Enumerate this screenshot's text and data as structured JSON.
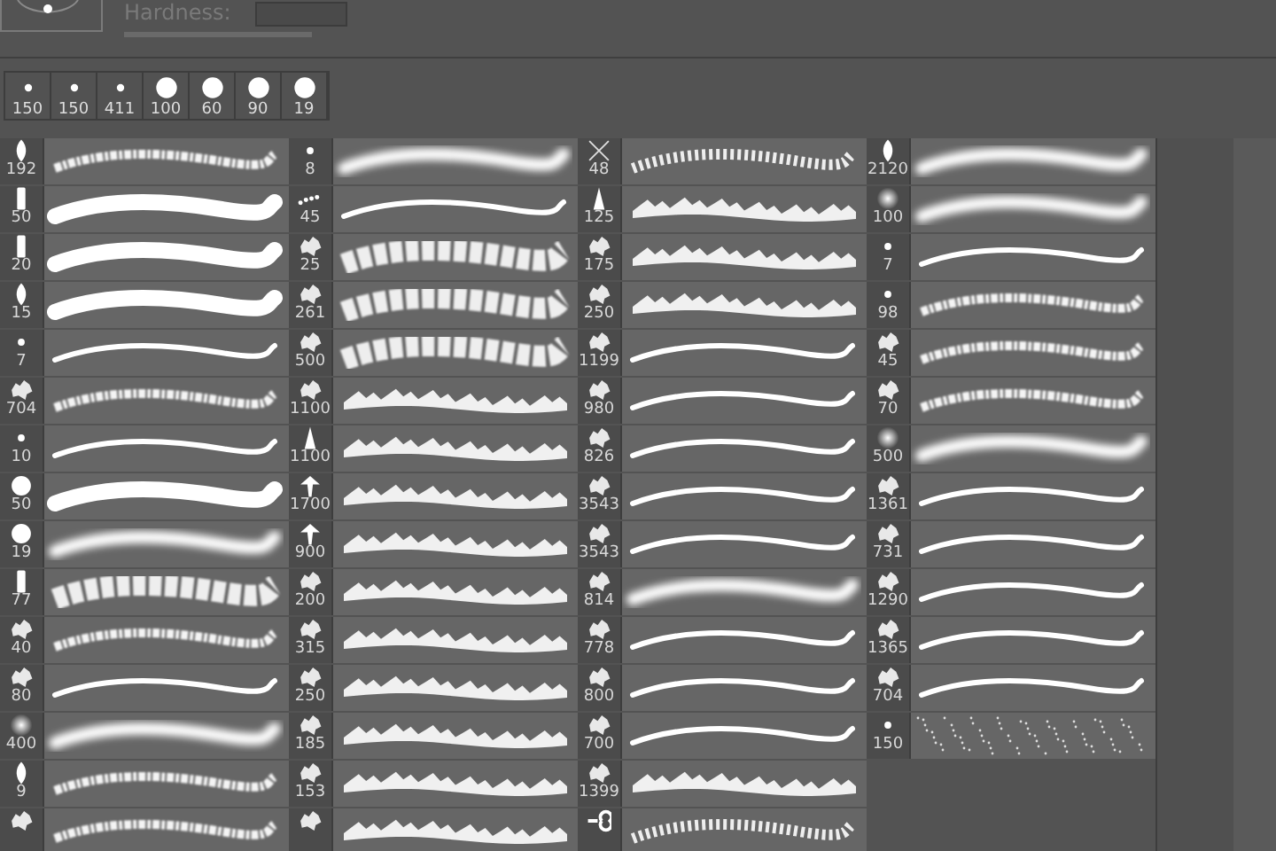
{
  "brush_settings": {
    "hardness_label": "Hardness:"
  },
  "recent_presets": [
    {
      "size": "150",
      "tip": {
        "kind": "dot"
      },
      "selected": false
    },
    {
      "size": "150",
      "tip": {
        "kind": "dot"
      },
      "selected": false
    },
    {
      "size": "411",
      "tip": {
        "kind": "dot"
      },
      "selected": false
    },
    {
      "size": "100",
      "tip": {
        "kind": "round"
      },
      "selected": false
    },
    {
      "size": "60",
      "tip": {
        "kind": "round"
      },
      "selected": false
    },
    {
      "size": "90",
      "tip": {
        "kind": "round"
      },
      "selected": false
    },
    {
      "size": "19",
      "tip": {
        "kind": "round"
      },
      "selected": false
    }
  ],
  "brush_columns": [
    {
      "items": [
        {
          "size": "192",
          "tip": {
            "kind": "leaf"
          },
          "stroke": {
            "kind": "rough"
          },
          "selected": false
        },
        {
          "size": "50",
          "tip": {
            "kind": "bar"
          },
          "stroke": {
            "kind": "thick"
          },
          "selected": false
        },
        {
          "size": "20",
          "tip": {
            "kind": "bar"
          },
          "stroke": {
            "kind": "thick"
          },
          "selected": false
        },
        {
          "size": "15",
          "tip": {
            "kind": "leaf"
          },
          "stroke": {
            "kind": "thick"
          },
          "selected": false
        },
        {
          "size": "7",
          "tip": {
            "kind": "dot"
          },
          "stroke": {
            "kind": "hard"
          },
          "selected": false
        },
        {
          "size": "704",
          "tip": {
            "kind": "blob"
          },
          "stroke": {
            "kind": "rough"
          },
          "selected": false
        },
        {
          "size": "10",
          "tip": {
            "kind": "dot"
          },
          "stroke": {
            "kind": "hard"
          },
          "selected": false
        },
        {
          "size": "50",
          "tip": {
            "kind": "round"
          },
          "stroke": {
            "kind": "thick"
          },
          "selected": false
        },
        {
          "size": "19",
          "tip": {
            "kind": "round"
          },
          "stroke": {
            "kind": "soft"
          },
          "selected": false
        },
        {
          "size": "77",
          "tip": {
            "kind": "bar"
          },
          "stroke": {
            "kind": "cloud"
          },
          "selected": false
        },
        {
          "size": "40",
          "tip": {
            "kind": "blob"
          },
          "stroke": {
            "kind": "rough"
          },
          "selected": false
        },
        {
          "size": "80",
          "tip": {
            "kind": "blob"
          },
          "stroke": {
            "kind": "hard"
          },
          "selected": false
        },
        {
          "size": "400",
          "tip": {
            "kind": "soft"
          },
          "stroke": {
            "kind": "soft"
          },
          "selected": false
        },
        {
          "size": "9",
          "tip": {
            "kind": "leaf"
          },
          "stroke": {
            "kind": "rough"
          },
          "selected": false
        },
        {
          "tip": {
            "kind": "blob"
          },
          "stroke": {
            "kind": "rough"
          },
          "selected": false
        }
      ]
    },
    {
      "items": [
        {
          "size": "8",
          "tip": {
            "kind": "dot"
          },
          "stroke": {
            "kind": "soft"
          },
          "selected": false
        },
        {
          "size": "45",
          "tip": {
            "kind": "dots"
          },
          "stroke": {
            "kind": "hard"
          },
          "selected": false
        },
        {
          "size": "25",
          "tip": {
            "kind": "blob"
          },
          "stroke": {
            "kind": "cloud"
          },
          "selected": false
        },
        {
          "size": "261",
          "tip": {
            "kind": "blob"
          },
          "stroke": {
            "kind": "cloud"
          },
          "selected": false
        },
        {
          "size": "500",
          "tip": {
            "kind": "blob"
          },
          "stroke": {
            "kind": "cloud"
          },
          "selected": false
        },
        {
          "size": "1100",
          "tip": {
            "kind": "blob"
          },
          "stroke": {
            "kind": "foliage"
          },
          "selected": false
        },
        {
          "size": "1100",
          "tip": {
            "kind": "cone"
          },
          "stroke": {
            "kind": "foliage"
          },
          "selected": false
        },
        {
          "size": "1700",
          "tip": {
            "kind": "tree"
          },
          "stroke": {
            "kind": "foliage"
          },
          "selected": false
        },
        {
          "size": "900",
          "tip": {
            "kind": "tree"
          },
          "stroke": {
            "kind": "foliage"
          },
          "selected": false
        },
        {
          "size": "200",
          "tip": {
            "kind": "blob"
          },
          "stroke": {
            "kind": "foliage"
          },
          "selected": false
        },
        {
          "size": "315",
          "tip": {
            "kind": "blob"
          },
          "stroke": {
            "kind": "foliage"
          },
          "selected": false
        },
        {
          "size": "250",
          "tip": {
            "kind": "blob"
          },
          "stroke": {
            "kind": "foliage"
          },
          "selected": false
        },
        {
          "size": "185",
          "tip": {
            "kind": "blob"
          },
          "stroke": {
            "kind": "foliage"
          },
          "selected": false
        },
        {
          "size": "153",
          "tip": {
            "kind": "blob"
          },
          "stroke": {
            "kind": "foliage"
          },
          "selected": false
        },
        {
          "tip": {
            "kind": "blob"
          },
          "stroke": {
            "kind": "foliage"
          },
          "selected": false
        }
      ]
    },
    {
      "items": [
        {
          "size": "48",
          "tip": {
            "kind": "cross"
          },
          "stroke": {
            "kind": "chain"
          },
          "selected": false
        },
        {
          "size": "125",
          "tip": {
            "kind": "cone"
          },
          "stroke": {
            "kind": "foliage"
          },
          "selected": false
        },
        {
          "size": "175",
          "tip": {
            "kind": "blob"
          },
          "stroke": {
            "kind": "foliage"
          },
          "selected": false
        },
        {
          "size": "250",
          "tip": {
            "kind": "blob"
          },
          "stroke": {
            "kind": "foliage"
          },
          "selected": false
        },
        {
          "size": "1199",
          "tip": {
            "kind": "blob"
          },
          "stroke": {
            "kind": "hard"
          },
          "selected": false
        },
        {
          "size": "980",
          "tip": {
            "kind": "blob"
          },
          "stroke": {
            "kind": "hard"
          },
          "selected": false
        },
        {
          "size": "826",
          "tip": {
            "kind": "blob"
          },
          "stroke": {
            "kind": "hard"
          },
          "selected": false
        },
        {
          "size": "3543",
          "tip": {
            "kind": "blob"
          },
          "stroke": {
            "kind": "hard"
          },
          "selected": false
        },
        {
          "size": "3543",
          "tip": {
            "kind": "blob"
          },
          "stroke": {
            "kind": "hard"
          },
          "selected": false
        },
        {
          "size": "814",
          "tip": {
            "kind": "blob"
          },
          "stroke": {
            "kind": "soft"
          },
          "selected": false
        },
        {
          "size": "778",
          "tip": {
            "kind": "blob"
          },
          "stroke": {
            "kind": "hard"
          },
          "selected": false
        },
        {
          "size": "800",
          "tip": {
            "kind": "blob"
          },
          "stroke": {
            "kind": "hard"
          },
          "selected": false
        },
        {
          "size": "700",
          "tip": {
            "kind": "blob"
          },
          "stroke": {
            "kind": "hard"
          },
          "selected": false
        },
        {
          "size": "1399",
          "tip": {
            "kind": "blob"
          },
          "stroke": {
            "kind": "foliage"
          },
          "selected": false
        },
        {
          "tip": {
            "kind": "chain"
          },
          "stroke": {
            "kind": "chain"
          },
          "selected": false
        }
      ]
    },
    {
      "items": [
        {
          "size": "2120",
          "tip": {
            "kind": "leaf"
          },
          "stroke": {
            "kind": "soft"
          },
          "selected": false
        },
        {
          "size": "100",
          "tip": {
            "kind": "soft"
          },
          "stroke": {
            "kind": "soft"
          },
          "selected": false
        },
        {
          "size": "7",
          "tip": {
            "kind": "dot"
          },
          "stroke": {
            "kind": "hard"
          },
          "selected": false
        },
        {
          "size": "98",
          "tip": {
            "kind": "dot"
          },
          "stroke": {
            "kind": "rough"
          },
          "selected": false
        },
        {
          "size": "45",
          "tip": {
            "kind": "blob"
          },
          "stroke": {
            "kind": "rough"
          },
          "selected": false
        },
        {
          "size": "70",
          "tip": {
            "kind": "blob"
          },
          "stroke": {
            "kind": "rough"
          },
          "selected": false
        },
        {
          "size": "500",
          "tip": {
            "kind": "soft"
          },
          "stroke": {
            "kind": "soft"
          },
          "selected": false
        },
        {
          "size": "1361",
          "tip": {
            "kind": "blob"
          },
          "stroke": {
            "kind": "hard"
          },
          "selected": false
        },
        {
          "size": "731",
          "tip": {
            "kind": "blob"
          },
          "stroke": {
            "kind": "hard"
          },
          "selected": false
        },
        {
          "size": "1290",
          "tip": {
            "kind": "blob"
          },
          "stroke": {
            "kind": "hard"
          },
          "selected": false
        },
        {
          "size": "1365",
          "tip": {
            "kind": "blob"
          },
          "stroke": {
            "kind": "hard"
          },
          "selected": false
        },
        {
          "size": "704",
          "tip": {
            "kind": "blob"
          },
          "stroke": {
            "kind": "hard"
          },
          "selected": false
        },
        {
          "size": "150",
          "tip": {
            "kind": "dot"
          },
          "stroke": {
            "kind": "spray"
          },
          "selected": false
        }
      ]
    }
  ]
}
